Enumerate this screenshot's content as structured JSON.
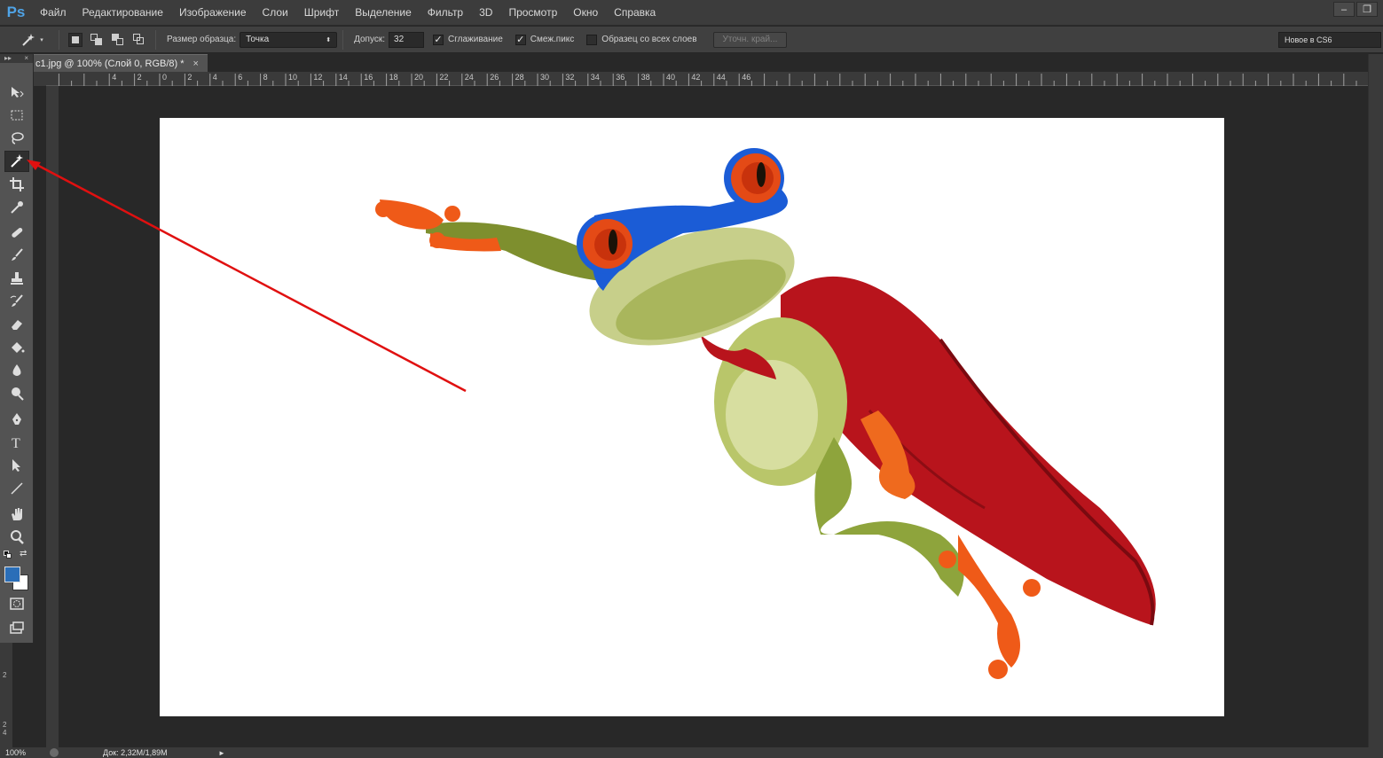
{
  "app": {
    "logo": "Ps"
  },
  "menu": [
    "Файл",
    "Редактирование",
    "Изображение",
    "Слои",
    "Шрифт",
    "Выделение",
    "Фильтр",
    "3D",
    "Просмотр",
    "Окно",
    "Справка"
  ],
  "window_controls": {
    "minimize": "–",
    "restore": "❐"
  },
  "options": {
    "sample_size_label": "Размер образца:",
    "sample_size_value": "Точка",
    "tolerance_label": "Допуск:",
    "tolerance_value": "32",
    "antialias_label": "Сглаживание",
    "antialias_checked": true,
    "contiguous_label": "Смеж.пикс",
    "contiguous_checked": true,
    "sample_all_label": "Образец со всех слоев",
    "sample_all_checked": false,
    "refine_edge_label": "Уточн. край...",
    "workspace_value": "Новое в CS6"
  },
  "document_tab": {
    "title": "c1.jpg @ 100% (Слой 0, RGB/8) *",
    "close": "×"
  },
  "ruler_h_labels": [
    "4",
    "2",
    "0",
    "2",
    "4",
    "6",
    "8",
    "10",
    "12",
    "14",
    "16",
    "18",
    "20",
    "22",
    "24",
    "26",
    "28",
    "30",
    "32",
    "34",
    "36",
    "38",
    "40",
    "42",
    "44",
    "46"
  ],
  "ruler_v_labels": [
    "2",
    "2",
    "4"
  ],
  "tools": [
    {
      "name": "move-tool-icon"
    },
    {
      "name": "marquee-tool-icon"
    },
    {
      "name": "lasso-tool-icon"
    },
    {
      "name": "magic-wand-tool-icon",
      "active": true
    },
    {
      "name": "crop-tool-icon"
    },
    {
      "name": "eyedropper-tool-icon"
    },
    {
      "name": "healing-brush-tool-icon"
    },
    {
      "name": "brush-tool-icon"
    },
    {
      "name": "clone-stamp-tool-icon"
    },
    {
      "name": "history-brush-tool-icon"
    },
    {
      "name": "eraser-tool-icon"
    },
    {
      "name": "paint-bucket-tool-icon"
    },
    {
      "name": "blur-tool-icon"
    },
    {
      "name": "dodge-tool-icon"
    },
    {
      "name": "pen-tool-icon"
    },
    {
      "name": "type-tool-icon"
    },
    {
      "name": "path-selection-tool-icon"
    },
    {
      "name": "line-tool-icon"
    },
    {
      "name": "hand-tool-icon"
    },
    {
      "name": "zoom-tool-icon"
    }
  ],
  "colors": {
    "foreground": "#2a6eb8",
    "background": "#ffffff",
    "annotation_arrow": "#e01010"
  },
  "status": {
    "zoom": "100%",
    "doc_info": "Док: 2,32M/1,89M",
    "arrow": "►"
  }
}
